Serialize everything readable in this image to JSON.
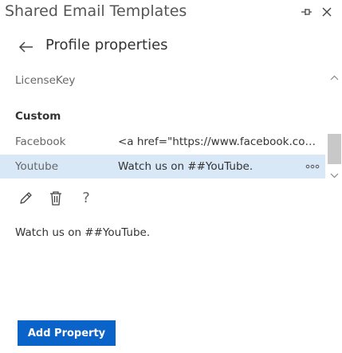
{
  "app": {
    "title": "Shared Email Templates"
  },
  "header": {
    "title": "Profile properties"
  },
  "properties": {
    "license_key_label": "LicenseKey",
    "section_custom": "Custom",
    "rows": [
      {
        "key": "Facebook",
        "value": "<a href=\"https://www.facebook.com/sharedemailtemplates\">Facebook</a>"
      },
      {
        "key": "Youtube",
        "value": "Watch us on ##YouTube."
      }
    ],
    "selected_index": 1
  },
  "icons": {
    "pin": "pin-icon",
    "close": "close-icon",
    "back": "arrow-left-icon",
    "edit": "pencil-icon",
    "delete": "trash-icon",
    "help": "question-icon",
    "more": "more-dots-icon",
    "help_glyph": "?"
  },
  "preview": {
    "text": "Watch us on ##YouTube."
  },
  "footer": {
    "add_button_label": "Add Property"
  },
  "colors": {
    "accent": "#0a63c8",
    "selected_row": "#d9e8f6",
    "scroll_thumb": "#c8c8c8"
  }
}
